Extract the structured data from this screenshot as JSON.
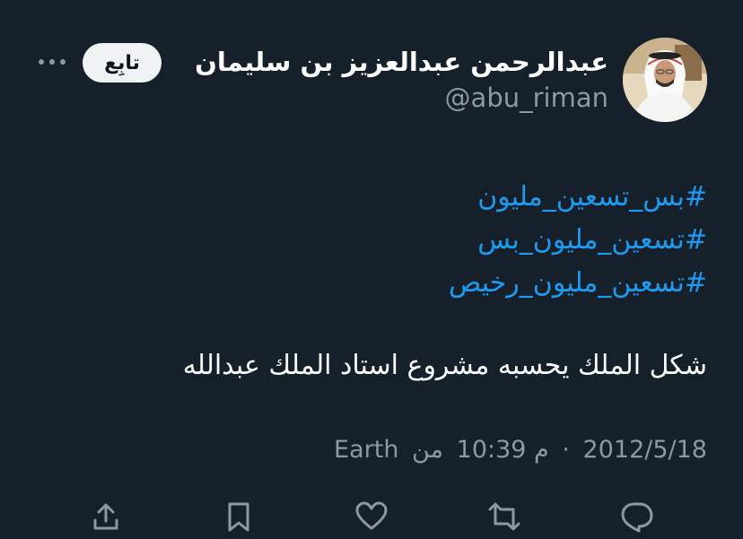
{
  "author": {
    "display_name": "عبدالرحمن عبدالعزيز بن سليمان",
    "handle": "@abu_riman"
  },
  "follow_button": {
    "label": "تابِع"
  },
  "tweet": {
    "hashtags": [
      "#بس_تسعين_مليون",
      "#تسعين_مليون_بس",
      "#تسعين_مليون_رخيص"
    ],
    "text": "شكل الملك يحسبه مشروع استاد الملك عبدالله"
  },
  "meta": {
    "date": "2012/5/18",
    "separator": "·",
    "time": "10:39 م",
    "source_prefix": "من",
    "source": "Earth"
  },
  "actions": [
    "share-icon",
    "bookmark-icon",
    "like-icon",
    "retweet-icon",
    "reply-icon"
  ],
  "colors": {
    "background": "#15202b",
    "link": "#1d9bf0",
    "secondary_text": "#8b98a5",
    "button_bg": "#eff3f4"
  }
}
